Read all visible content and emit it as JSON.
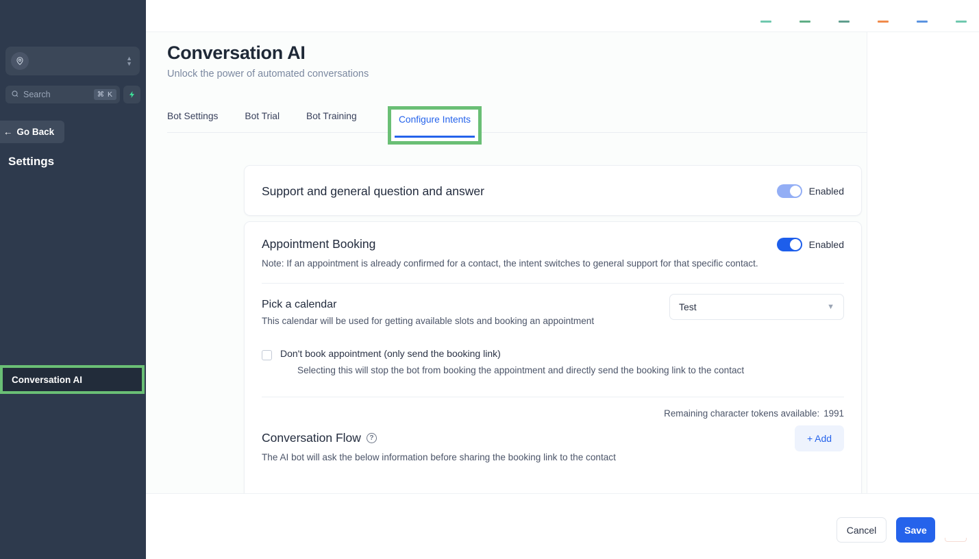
{
  "sidebar": {
    "org_switcher": {
      "icon": "user-location-icon",
      "caret_icon": "chevron-up-down-icon"
    },
    "search": {
      "placeholder": "Search",
      "icon": "search-icon",
      "shortcut": "⌘ K"
    },
    "quick_action": {
      "icon": "lightning-bolt-icon"
    },
    "go_back": {
      "label": "Go Back",
      "icon": "arrow-left-icon"
    },
    "section_title": "Settings",
    "active_item": {
      "label": "Conversation AI",
      "highlighted": true
    }
  },
  "topbar": {
    "icon_dots": [
      "#6fc8ae",
      "#5fae86",
      "#5f9e8e",
      "#f08a4b",
      "#5b93e0",
      "#6fc8ae"
    ]
  },
  "page": {
    "title": "Conversation AI",
    "subtitle": "Unlock the power of automated conversations"
  },
  "tabs": {
    "items": [
      {
        "label": "Bot Settings",
        "active": false
      },
      {
        "label": "Bot Trial",
        "active": false
      },
      {
        "label": "Bot Training",
        "active": false
      }
    ],
    "highlighted_tab": {
      "label": "Configure Intents",
      "active": true
    }
  },
  "support_card": {
    "heading": "Support and general question and answer",
    "toggle": {
      "state": "on",
      "style": "light",
      "label": "Enabled"
    }
  },
  "booking_card": {
    "heading": "Appointment Booking",
    "toggle": {
      "state": "on",
      "style": "solid",
      "label": "Enabled"
    },
    "note": "Note: If an appointment is already confirmed for a contact, the intent switches to general support for that specific contact.",
    "calendar": {
      "label": "Pick a calendar",
      "help": "This calendar will be used for getting available slots and booking an appointment",
      "selected": "Test",
      "chevron_icon": "chevron-down-icon"
    },
    "no_book_checkbox": {
      "checked": false,
      "label": "Don't book appointment (only send the booking link)",
      "help": "Selecting this will stop the bot from booking the appointment and directly send the booking link to the contact"
    },
    "tokens": {
      "label": "Remaining character tokens available:",
      "value": "1991"
    },
    "conversation_flow": {
      "title": "Conversation Flow",
      "help_icon": "question-mark-circle-icon",
      "help": "The AI bot will ask the below information before sharing the booking link to the contact",
      "add_button": {
        "label": "Add",
        "icon": "plus-icon"
      }
    }
  },
  "footer": {
    "cancel_label": "Cancel",
    "save_label": "Save"
  },
  "colors": {
    "sidebar_bg": "#2e3a4d",
    "highlight_green": "#6abf75",
    "accent_blue": "#2563eb",
    "toggle_light": "#93aef5",
    "toggle_solid": "#1d5eeb",
    "bolt_green": "#3ddc97"
  }
}
